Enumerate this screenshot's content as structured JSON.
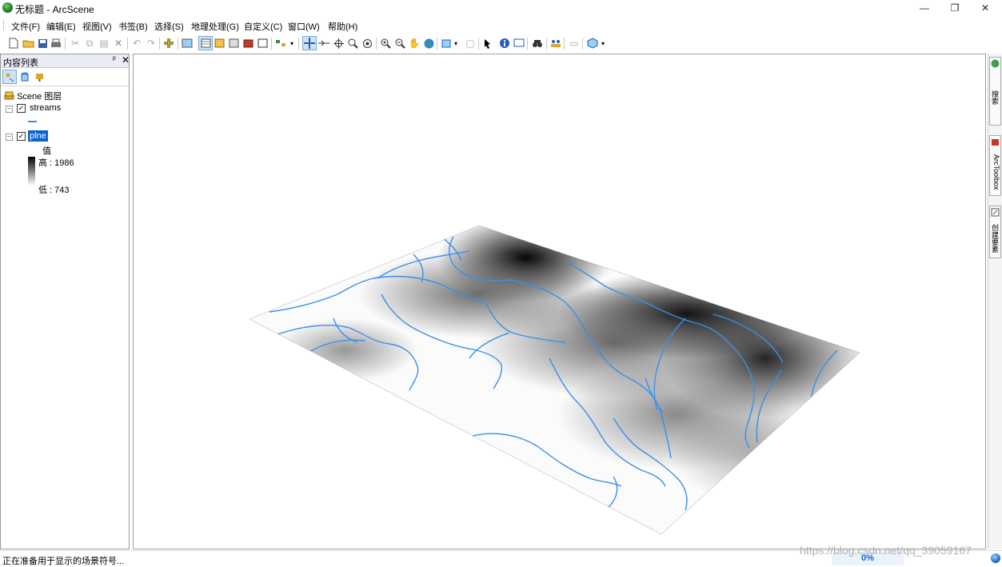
{
  "window": {
    "title": "无标题 - ArcScene",
    "min_glyph": "—",
    "max_glyph": "❐",
    "close_glyph": "✕"
  },
  "menu": [
    "文件(F)",
    "编辑(E)",
    "视图(V)",
    "书签(B)",
    "选择(S)",
    "地理处理(G)",
    "自定义(C)",
    "窗口(W)",
    "帮助(H)"
  ],
  "toc": {
    "title": "内容列表",
    "pin_glyph": "ᵖ",
    "close_glyph": "✕",
    "scene_label": "Scene 图层",
    "layers": [
      {
        "name": "streams",
        "checked": "✓",
        "expander": "−"
      },
      {
        "name": "plne",
        "checked": "✓",
        "expander": "−"
      }
    ],
    "legend_title": "值",
    "legend_high": "高 : 1986",
    "legend_low": "低 : 743"
  },
  "status": {
    "text": "正在准备用于显示的场景符号...",
    "progress": "0%"
  },
  "watermark": "https://blog.csdn.net/qq_39059167",
  "dock_tabs": [
    "搜索",
    "ArcToolbox",
    "创建要素"
  ],
  "colors": {
    "stream": "#3a8fe8",
    "selection": "#0a64d0",
    "relief_high": "#000000",
    "relief_low": "#ffffff"
  }
}
